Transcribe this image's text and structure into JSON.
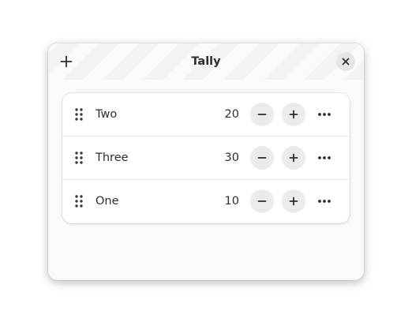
{
  "window": {
    "title": "Tally"
  },
  "header": {
    "add_icon": "plus-icon",
    "close_icon": "close-icon"
  },
  "counters": [
    {
      "name": "Two",
      "value": "20"
    },
    {
      "name": "Three",
      "value": "30"
    },
    {
      "name": "One",
      "value": "10"
    }
  ],
  "row_icons": {
    "handle": "drag-handle-icon",
    "decrement": "minus-icon",
    "increment": "plus-icon",
    "menu": "more-icon"
  },
  "colors": {
    "window_bg": "#fafafa",
    "card_bg": "#ffffff",
    "button_bg": "#ebebeb",
    "text": "#2e2e2e"
  }
}
